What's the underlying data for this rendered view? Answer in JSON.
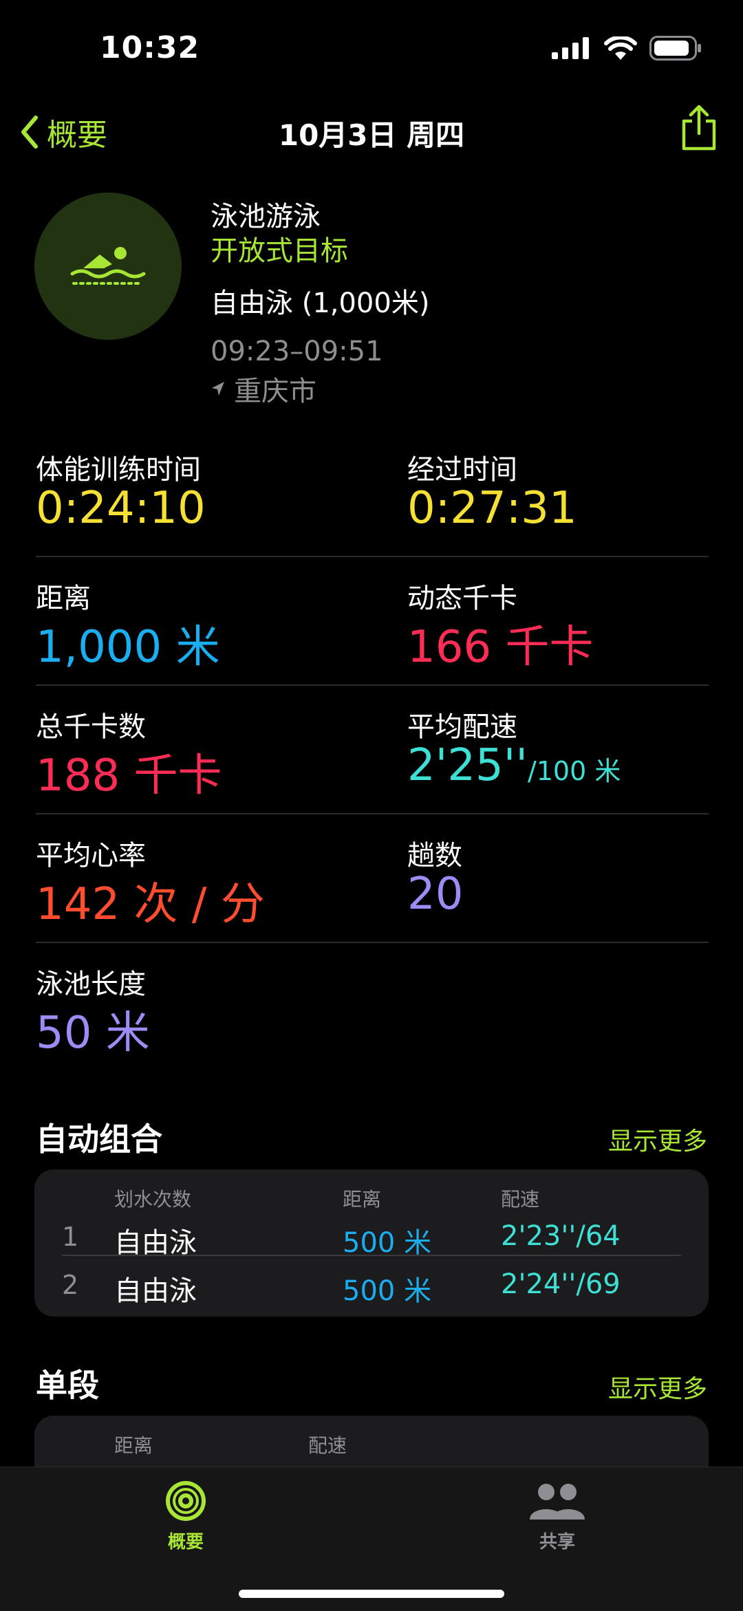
{
  "status": {
    "time": "10:32"
  },
  "nav": {
    "back_label": "概要",
    "title": "10月3日 周四"
  },
  "workout": {
    "name": "泳池游泳",
    "goal": "开放式目标",
    "style": "自由泳 (1,000米)",
    "time_range": "09:23–09:51",
    "location": "重庆市"
  },
  "stats": {
    "workout_time": {
      "label": "体能训练时间",
      "value": "0:24:10"
    },
    "elapsed_time": {
      "label": "经过时间",
      "value": "0:27:31"
    },
    "distance": {
      "label": "距离",
      "value": "1,000 米"
    },
    "active_kcal": {
      "label": "动态千卡",
      "value": "166 千卡"
    },
    "total_kcal": {
      "label": "总千卡数",
      "value": "188 千卡"
    },
    "avg_pace": {
      "label": "平均配速",
      "value": "2'25''",
      "unit": "/100 米"
    },
    "avg_hr": {
      "label": "平均心率",
      "value": "142 次 / 分"
    },
    "laps": {
      "label": "趟数",
      "value": "20"
    },
    "pool_length": {
      "label": "泳池长度",
      "value": "50 米"
    }
  },
  "auto_sets": {
    "title": "自动组合",
    "more": "显示更多",
    "headers": {
      "strokes": "划水次数",
      "distance": "距离",
      "pace": "配速"
    },
    "rows": [
      {
        "idx": "1",
        "stroke": "自由泳",
        "distance": "500 米",
        "pace": "2'23''/64"
      },
      {
        "idx": "2",
        "stroke": "自由泳",
        "distance": "500 米",
        "pace": "2'24''/69"
      }
    ]
  },
  "splits": {
    "title": "单段",
    "more": "显示更多",
    "headers": {
      "distance": "距离",
      "pace": "配速"
    }
  },
  "tabbar": {
    "summary_label": "概要",
    "sharing_label": "共享"
  },
  "colors": {
    "accent": "#a8e635",
    "yellow": "#f7e034",
    "blue": "#1aaef0",
    "pink": "#ff2d55",
    "cyan": "#3ee0d6",
    "orange": "#ff4d2e",
    "purple": "#9d8cf5"
  }
}
